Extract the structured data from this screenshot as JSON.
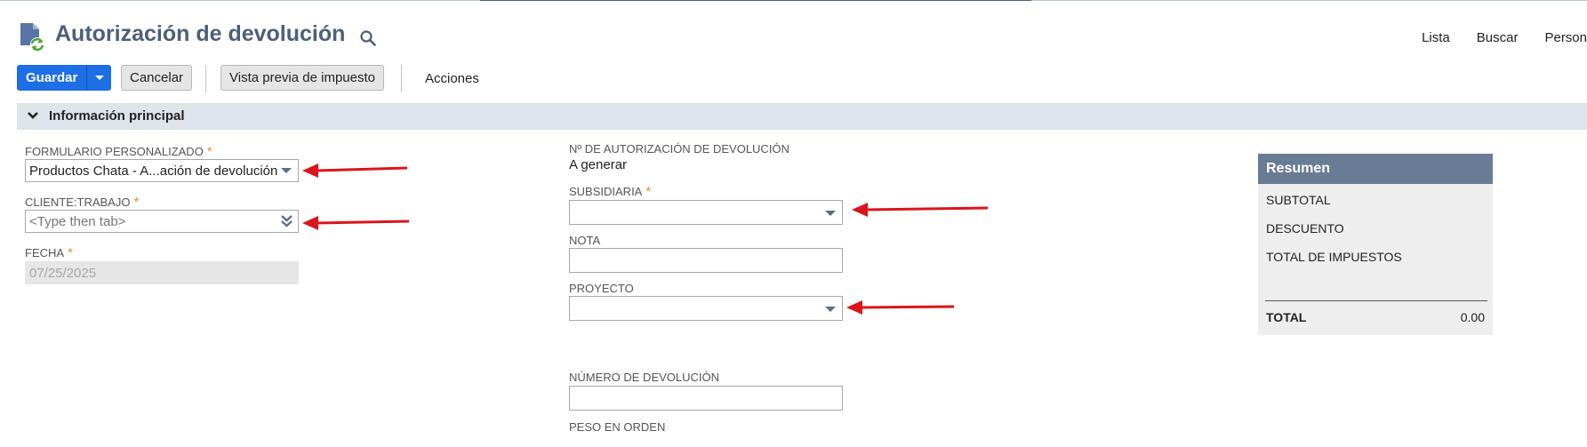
{
  "header": {
    "title": "Autorización de devolución",
    "record_icon": "return-document-icon",
    "links": [
      "Lista",
      "Buscar",
      "Person"
    ]
  },
  "toolbar": {
    "save_label": "Guardar",
    "cancel_label": "Cancelar",
    "tax_preview_label": "Vista previa de impuesto",
    "actions_label": "Acciones"
  },
  "section": {
    "title": "Información principal"
  },
  "fields": {
    "custom_form": {
      "label": "FORMULARIO PERSONALIZADO",
      "value": "Productos Chata - A...ación de devolución"
    },
    "customer_job": {
      "label": "CLIENTE:TRABAJO",
      "placeholder": "<Type then tab>"
    },
    "date": {
      "label": "FECHA",
      "value": "07/25/2025"
    },
    "rma_number": {
      "label": "Nº DE AUTORIZACIÓN DE DEVOLUCIÓN",
      "value": "A generar"
    },
    "subsidiary": {
      "label": "SUBSIDIARIA",
      "value": ""
    },
    "memo": {
      "label": "NOTA",
      "value": ""
    },
    "project": {
      "label": "PROYECTO",
      "value": ""
    },
    "return_number": {
      "label": "NÚMERO DE DEVOLUCIÓN",
      "value": ""
    },
    "order_weight": {
      "label": "PESO EN ORDEN"
    }
  },
  "summary": {
    "title": "Resumen",
    "subtotal_label": "SUBTOTAL",
    "discount_label": "DESCUENTO",
    "tax_total_label": "TOTAL DE IMPUESTOS",
    "total_label": "TOTAL",
    "total_value": "0.00"
  },
  "colors": {
    "primary_button": "#1e6ee6",
    "title_text": "#4d5f79",
    "section_bar": "#dfe3ea",
    "summary_header": "#6a7b95",
    "required_asterisk": "#e7912c",
    "annotation_arrow": "#d9161c"
  }
}
